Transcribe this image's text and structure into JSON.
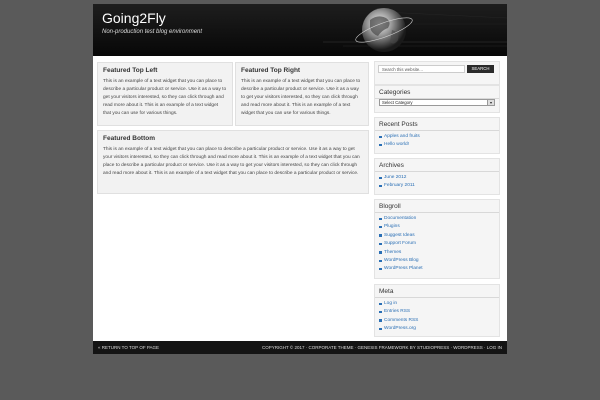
{
  "header": {
    "title": "Going2Fly",
    "description": "Non-production test blog environment"
  },
  "featured": {
    "top_left": {
      "title": "Featured Top Left",
      "text": "This is an example of a text widget that you can place to describe a particular product or service. Use it as a way to get your visitors interested, so they can click through and read more about it. This is an example of a text widget that you can use for various things."
    },
    "top_right": {
      "title": "Featured Top Right",
      "text": "This is an example of a text widget that you can place to describe a particular product or service. Use it as a way to get your visitors interested, so they can click through and read more about it. This is an example of a text widget that you can use for various things."
    },
    "bottom": {
      "title": "Featured Bottom",
      "text": "This is an example of a text widget that you can place to describe a particular product or service. Use it as a way to get your visitors interested, so they can click through and read more about it. This is an example of a text widget that you can place to describe a particular product or service. Use it as a way to get your visitors interested, so they can click through and read more about it. This is an example of a text widget that you can place to describe a particular product or service."
    }
  },
  "search": {
    "placeholder": "Search this website...",
    "button": "SEARCH"
  },
  "sidebar": {
    "categories": {
      "title": "Categories",
      "selected": "Select Category"
    },
    "recent_posts": {
      "title": "Recent Posts",
      "items": [
        "Apples and fruits",
        "Hello world!"
      ]
    },
    "archives": {
      "title": "Archives",
      "items": [
        "June 2012",
        "February 2011"
      ]
    },
    "blogroll": {
      "title": "Blogroll",
      "items": [
        "Documentation",
        "Plugins",
        "Suggest Ideas",
        "Support Forum",
        "Themes",
        "WordPress Blog",
        "WordPress Planet"
      ]
    },
    "meta": {
      "title": "Meta",
      "items": [
        "Log in",
        "Entries RSS",
        "Comments RSS",
        "WordPress.org"
      ]
    }
  },
  "footer": {
    "left": "« RETURN TO TOP OF PAGE",
    "right": "COPYRIGHT © 2017 · CORPORATE THEME · GENESIS FRAMEWORK BY STUDIOPRESS · WORDPRESS · LOG IN"
  }
}
